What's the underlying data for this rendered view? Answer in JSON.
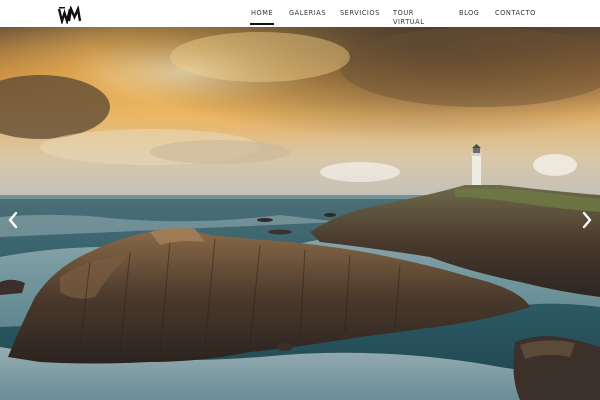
{
  "header": {
    "logo_icon": "wm-monogram-logo",
    "nav": [
      {
        "label": "HOME",
        "active": true
      },
      {
        "label": "GALERIAS",
        "active": false
      },
      {
        "label": "SERVICIOS",
        "active": false
      },
      {
        "label": "TOUR VIRTUAL",
        "active": false
      },
      {
        "label": "BLOG",
        "active": false
      },
      {
        "label": "CONTACTO",
        "active": false
      }
    ]
  },
  "slider": {
    "prev_icon": "chevron-left-icon",
    "next_icon": "chevron-right-icon"
  },
  "colors": {
    "nav_text": "#333333",
    "active_underline": "#111111",
    "sky_gold": "#e9a84a",
    "sea_teal": "#2f5f68"
  }
}
